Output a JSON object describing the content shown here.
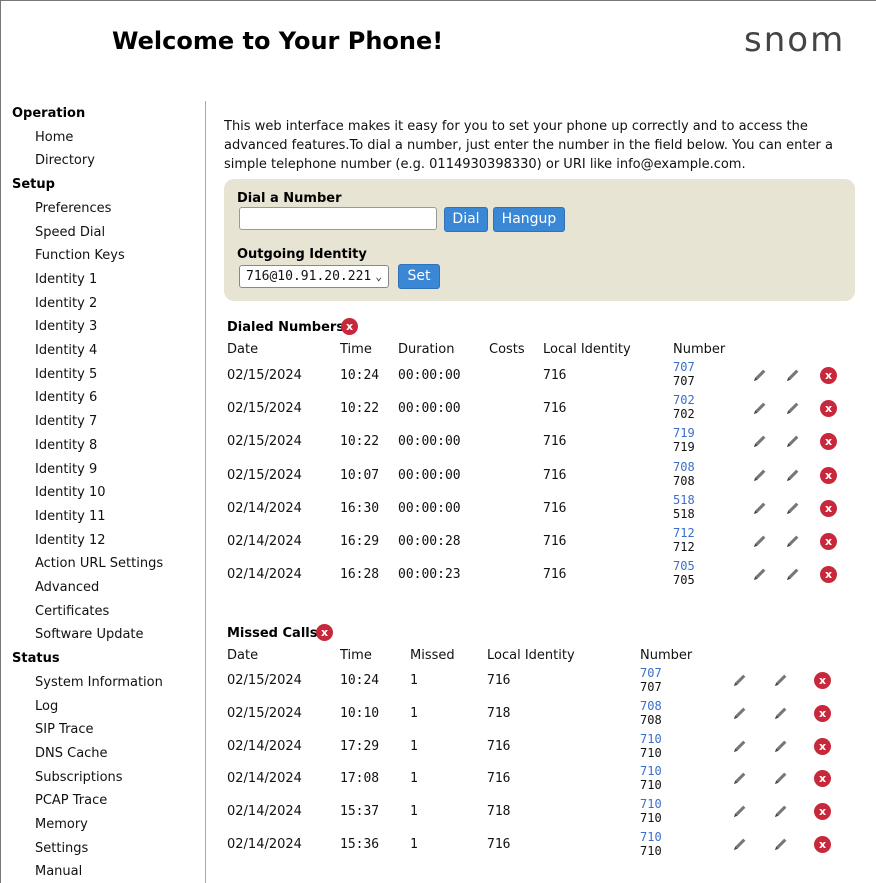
{
  "header": {
    "title": "Welcome to Your Phone!",
    "logo": "snom"
  },
  "sidebar": {
    "sections": [
      {
        "heading": "Operation",
        "items": [
          "Home",
          "Directory"
        ]
      },
      {
        "heading": "Setup",
        "items": [
          "Preferences",
          "Speed Dial",
          "Function Keys",
          "Identity 1",
          "Identity 2",
          "Identity 3",
          "Identity 4",
          "Identity 5",
          "Identity 6",
          "Identity 7",
          "Identity 8",
          "Identity 9",
          "Identity 10",
          "Identity 11",
          "Identity 12",
          "Action URL Settings",
          "Advanced",
          "Certificates",
          "Software Update"
        ]
      },
      {
        "heading": "Status",
        "items": [
          "System Information",
          "Log",
          "SIP Trace",
          "DNS Cache",
          "Subscriptions",
          "PCAP Trace",
          "Memory",
          "Settings",
          "Manual"
        ]
      }
    ]
  },
  "intro": "This web interface makes it easy for you to set your phone up correctly and to access the advanced features.To dial a number, just enter the number in the field below. You can enter a simple telephone number (e.g. 0114930398330) or URI like info@example.com.",
  "dial": {
    "label": "Dial a Number",
    "input_value": "",
    "dial_button": "Dial",
    "hangup_button": "Hangup",
    "identity_label": "Outgoing Identity",
    "identity_value": "716@10.91.20.221",
    "set_button": "Set"
  },
  "dialed": {
    "title": "Dialed Numbers",
    "headers": [
      "Date",
      "Time",
      "Duration",
      "Costs",
      "Local Identity",
      "Number"
    ],
    "rows": [
      {
        "date": "02/15/2024",
        "time": "10:24",
        "duration": "00:00:00",
        "costs": "",
        "local": "716",
        "number_link": "707",
        "number": "707"
      },
      {
        "date": "02/15/2024",
        "time": "10:22",
        "duration": "00:00:00",
        "costs": "",
        "local": "716",
        "number_link": "702",
        "number": "702"
      },
      {
        "date": "02/15/2024",
        "time": "10:22",
        "duration": "00:00:00",
        "costs": "",
        "local": "716",
        "number_link": "719",
        "number": "719"
      },
      {
        "date": "02/15/2024",
        "time": "10:07",
        "duration": "00:00:00",
        "costs": "",
        "local": "716",
        "number_link": "708",
        "number": "708"
      },
      {
        "date": "02/14/2024",
        "time": "16:30",
        "duration": "00:00:00",
        "costs": "",
        "local": "716",
        "number_link": "518",
        "number": "518"
      },
      {
        "date": "02/14/2024",
        "time": "16:29",
        "duration": "00:00:28",
        "costs": "",
        "local": "716",
        "number_link": "712",
        "number": "712"
      },
      {
        "date": "02/14/2024",
        "time": "16:28",
        "duration": "00:00:23",
        "costs": "",
        "local": "716",
        "number_link": "705",
        "number": "705"
      }
    ]
  },
  "missed": {
    "title": "Missed Calls",
    "headers": [
      "Date",
      "Time",
      "Missed",
      "Local Identity",
      "Number"
    ],
    "rows": [
      {
        "date": "02/15/2024",
        "time": "10:24",
        "missed": "1",
        "local": "716",
        "number_link": "707",
        "number": "707"
      },
      {
        "date": "02/15/2024",
        "time": "10:10",
        "missed": "1",
        "local": "718",
        "number_link": "708",
        "number": "708"
      },
      {
        "date": "02/14/2024",
        "time": "17:29",
        "missed": "1",
        "local": "716",
        "number_link": "710",
        "number": "710"
      },
      {
        "date": "02/14/2024",
        "time": "17:08",
        "missed": "1",
        "local": "716",
        "number_link": "710",
        "number": "710"
      },
      {
        "date": "02/14/2024",
        "time": "15:37",
        "missed": "1",
        "local": "718",
        "number_link": "710",
        "number": "710"
      },
      {
        "date": "02/14/2024",
        "time": "15:36",
        "missed": "1",
        "local": "716",
        "number_link": "710",
        "number": "710"
      }
    ]
  },
  "icons": {
    "delete": "delete-x-icon",
    "edit": "pencil-icon",
    "dropdown": "chevron-down-icon"
  },
  "colors": {
    "accent": "#3a87d6",
    "delete": "#c8283b",
    "panel": "#e8e4d4",
    "link": "#3a6fc9"
  }
}
